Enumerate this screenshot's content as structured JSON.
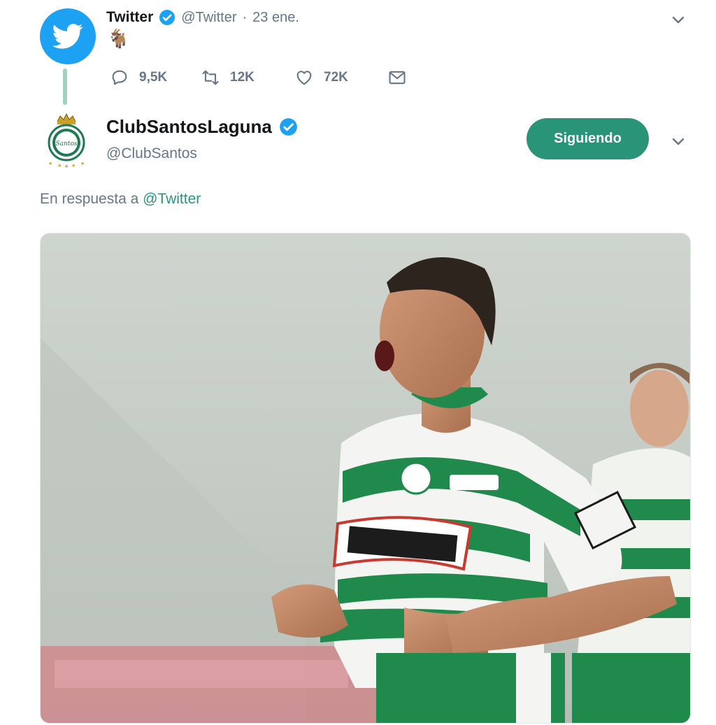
{
  "parent_tweet": {
    "author_name": "Twitter",
    "author_handle": "@Twitter",
    "separator": "·",
    "date": "23 ene.",
    "emoji": "🐐",
    "actions": {
      "replies": "9,5K",
      "retweets": "12K",
      "likes": "72K"
    },
    "icons": [
      "twitter-bird-icon",
      "verified-icon",
      "chevron-down-icon",
      "reply-icon",
      "retweet-icon",
      "heart-icon",
      "mail-icon"
    ]
  },
  "reply_tweet": {
    "author_name": "ClubSantosLaguna",
    "author_handle": "@ClubSantos",
    "follow_button": "Siguiendo",
    "reply_prefix": "En respuesta a",
    "reply_mention": "@Twitter"
  },
  "colors": {
    "twitter_blue": "#1da1f2",
    "santos_green": "#2a9478",
    "muted_text": "#657786"
  }
}
